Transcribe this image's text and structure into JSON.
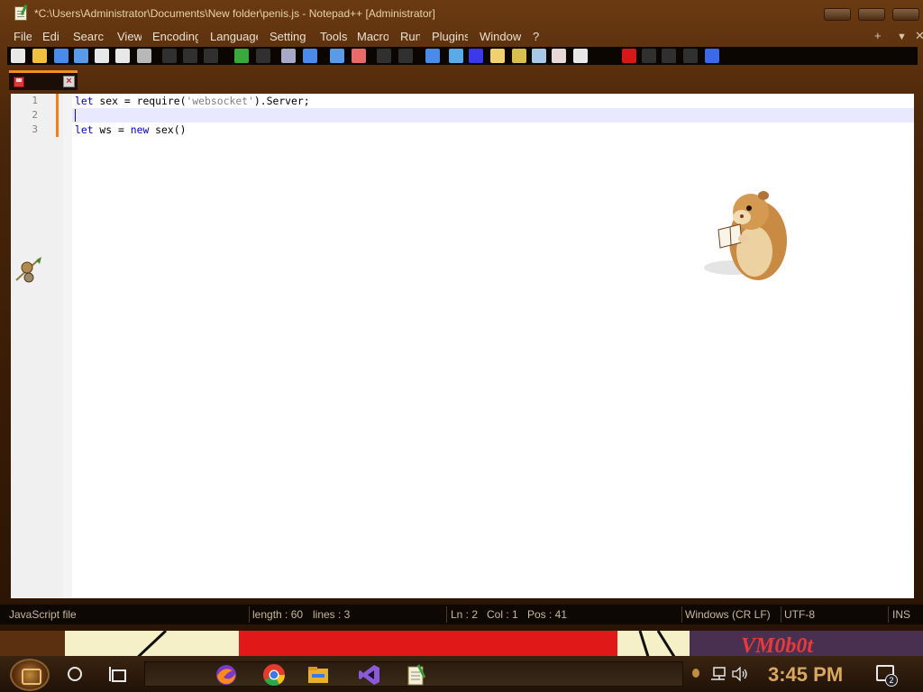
{
  "window": {
    "title": "*C:\\Users\\Administrator\\Documents\\New folder\\penis.js - Notepad++ [Administrator]"
  },
  "menu": {
    "items": [
      "File",
      "Edit",
      "Search",
      "View",
      "Encoding",
      "Language",
      "Settings",
      "Tools",
      "Macro",
      "Run",
      "Plugins",
      "Window",
      "?"
    ],
    "shown": [
      "File",
      "Edi",
      "Searc",
      "View",
      "Encoding",
      "Language",
      "Setting",
      "Tools",
      "Macro",
      "Run",
      "Plugins",
      "Window",
      "?"
    ],
    "right": [
      "+",
      "▼",
      "✕"
    ]
  },
  "toolbar": {
    "icons": [
      "new-file-icon",
      "open-file-icon",
      "save-icon",
      "save-all-icon",
      "close-icon",
      "close-all-icon",
      "print-icon",
      "cut-icon",
      "copy-icon",
      "paste-icon",
      "undo-icon",
      "redo-icon",
      "find-icon",
      "replace-icon",
      "zoom-in-icon",
      "zoom-out-icon",
      "sync-v-icon",
      "sync-h-icon",
      "word-wrap-icon",
      "show-all-chars-icon",
      "indent-guide-icon",
      "udl-icon",
      "doc-map-icon",
      "function-list-icon",
      "folder-as-workspace-icon",
      "monitoring-icon",
      "record-macro-icon",
      "stop-macro-icon",
      "play-macro-icon",
      "run-macro-multiple-icon",
      "save-macro-icon"
    ]
  },
  "tab": {
    "label": "",
    "modified": true
  },
  "editor": {
    "lines": [
      {
        "number": "1",
        "tokens": [
          {
            "t": "let",
            "c": "kw"
          },
          {
            "t": " sex = require(",
            "c": ""
          },
          {
            "t": "'websocket'",
            "c": "str"
          },
          {
            "t": ").Server;",
            "c": ""
          }
        ]
      },
      {
        "number": "2",
        "tokens": []
      },
      {
        "number": "3",
        "tokens": [
          {
            "t": "let",
            "c": "kw"
          },
          {
            "t": " ws = ",
            "c": ""
          },
          {
            "t": "new",
            "c": "kw"
          },
          {
            "t": " sex()",
            "c": ""
          }
        ]
      }
    ],
    "current_line": 2
  },
  "status": {
    "file_type": "JavaScript file",
    "length": "length : 60",
    "lines": "lines : 3",
    "ln": "Ln : 2",
    "col": "Col : 1",
    "pos": "Pos : 41",
    "eol": "Windows (CR LF)",
    "encoding": "UTF-8",
    "mode": "INS"
  },
  "wallpaper": {
    "logo": "VM0b0t"
  },
  "taskbar": {
    "apps": [
      "firefox-icon",
      "chrome-icon",
      "file-explorer-icon",
      "visual-studio-icon",
      "notepadpp-icon"
    ],
    "clock": "3:45 PM",
    "notifications": "2"
  },
  "colors": {
    "accent": "#f09020",
    "keyword": "#0000c0",
    "string": "#808080",
    "clock": "#d8a860"
  }
}
